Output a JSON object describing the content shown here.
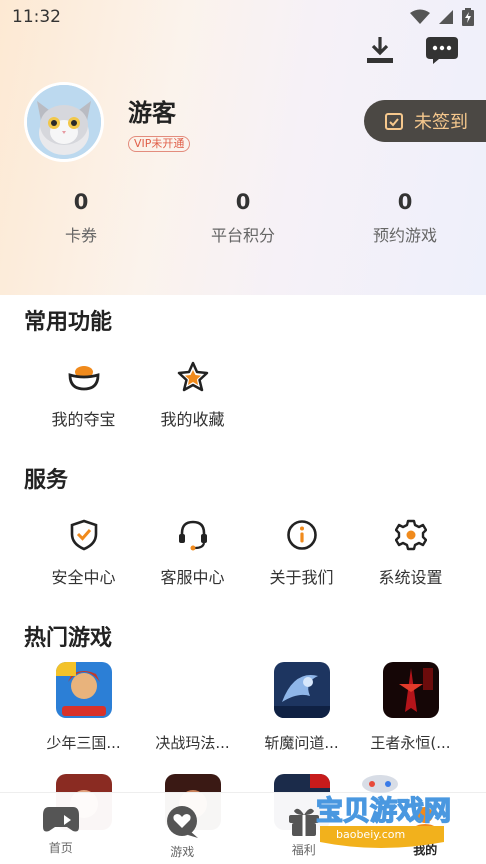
{
  "status_bar": {
    "time": "11:32",
    "icons": [
      "wifi-icon",
      "cell-signal-icon",
      "battery-icon"
    ]
  },
  "header": {
    "actions": [
      "download-icon",
      "message-icon"
    ]
  },
  "profile": {
    "name": "游客",
    "vip_status": "VIP未开通",
    "checkin_label": "未签到"
  },
  "stats": [
    {
      "value": "0",
      "label": "卡券"
    },
    {
      "value": "0",
      "label": "平台积分"
    },
    {
      "value": "0",
      "label": "预约游戏"
    }
  ],
  "common_functions": {
    "title": "常用功能",
    "items": [
      {
        "label": "我的夺宝",
        "icon": "treasure-bowl-icon"
      },
      {
        "label": "我的收藏",
        "icon": "star-icon"
      }
    ]
  },
  "services": {
    "title": "服务",
    "items": [
      {
        "label": "安全中心",
        "icon": "shield-check-icon"
      },
      {
        "label": "客服中心",
        "icon": "headset-icon"
      },
      {
        "label": "关于我们",
        "icon": "info-icon"
      },
      {
        "label": "系统设置",
        "icon": "gear-icon"
      }
    ]
  },
  "hot_games": {
    "title": "热门游戏",
    "items": [
      {
        "label": "少年三国..."
      },
      {
        "label": "决战玛法..."
      },
      {
        "label": "斩魔问道..."
      },
      {
        "label": "王者永恒(..."
      }
    ]
  },
  "bottom_nav": {
    "items": [
      {
        "label": "首页",
        "icon": "gamepad-icon"
      },
      {
        "label": "游戏",
        "icon": "heart-bubble-icon"
      },
      {
        "label": "福利",
        "icon": "gift-icon"
      },
      {
        "label": "我的",
        "icon": "profile-icon"
      }
    ]
  },
  "watermark": {
    "title": "宝贝游戏网",
    "url": "baobeiy.com"
  },
  "colors": {
    "accent": "#f08a1c",
    "checkin_bg": "#4b4844",
    "checkin_text": "#f6c88d"
  }
}
